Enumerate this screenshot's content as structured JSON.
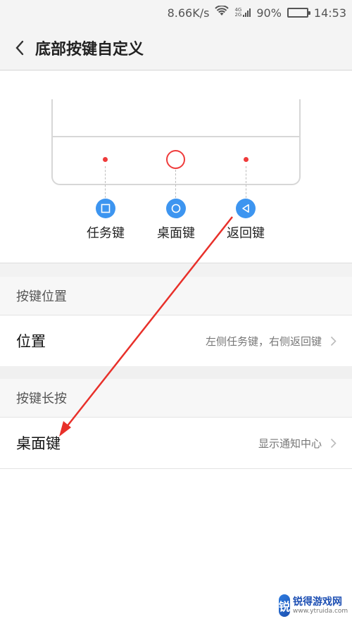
{
  "status_bar": {
    "speed": "8.66K/s",
    "net_top": "4G",
    "net_bottom": "2G",
    "battery_text": "90%",
    "battery_level": 0.9,
    "time": "14:53"
  },
  "header": {
    "title": "底部按键自定义"
  },
  "preview": {
    "keys": [
      {
        "label": "任务键",
        "icon": "square-icon"
      },
      {
        "label": "桌面键",
        "icon": "circle-icon"
      },
      {
        "label": "返回键",
        "icon": "triangle-back-icon"
      }
    ]
  },
  "sections": [
    {
      "header": "按键位置",
      "row": {
        "label": "位置",
        "value": "左侧任务键，右侧返回键"
      }
    },
    {
      "header": "按键长按",
      "row": {
        "label": "桌面键",
        "value": "显示通知中心"
      }
    }
  ],
  "watermark": {
    "logo_char": "锐",
    "name": "锐得游戏网",
    "url": "www.ytruida.com"
  },
  "colors": {
    "accent_blue": "#3d95f0",
    "dot_red": "#ef3b3b",
    "arrow_red": "#e8302a"
  }
}
